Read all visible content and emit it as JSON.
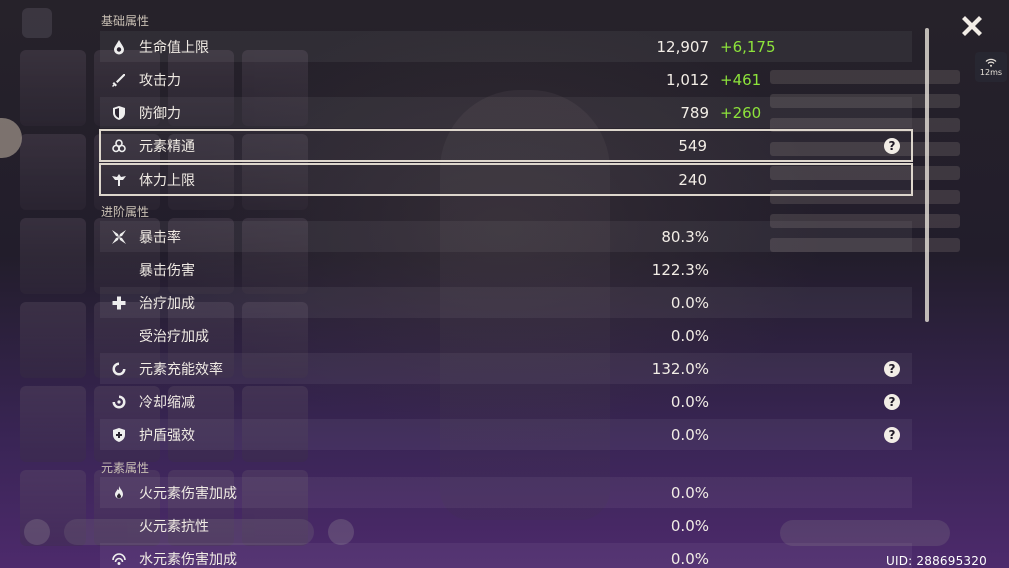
{
  "sections": {
    "base": "基础属性",
    "advanced": "进阶属性",
    "elemental": "元素属性"
  },
  "base_rows": [
    {
      "icon": "hp-drop-icon",
      "name": "生命值上限",
      "value": "12,907",
      "bonus": "+6,175"
    },
    {
      "icon": "sword-icon",
      "name": "攻击力",
      "value": "1,012",
      "bonus": "+461"
    },
    {
      "icon": "shield-icon",
      "name": "防御力",
      "value": "789",
      "bonus": "+260"
    },
    {
      "icon": "elemental-mastery-icon",
      "name": "元素精通",
      "value": "549",
      "help": "?"
    },
    {
      "icon": "stamina-icon",
      "name": "体力上限",
      "value": "240"
    }
  ],
  "advanced_rows": [
    {
      "icon": "crit-rate-icon",
      "name": "暴击率",
      "value": "80.3%"
    },
    {
      "icon": "",
      "name": "暴击伤害",
      "value": "122.3%"
    },
    {
      "icon": "healing-cross-icon",
      "name": "治疗加成",
      "value": "0.0%"
    },
    {
      "icon": "",
      "name": "受治疗加成",
      "value": "0.0%"
    },
    {
      "icon": "energy-recharge-icon",
      "name": "元素充能效率",
      "value": "132.0%",
      "help": "?"
    },
    {
      "icon": "cooldown-icon",
      "name": "冷却缩减",
      "value": "0.0%",
      "help": "?"
    },
    {
      "icon": "shield-strength-icon",
      "name": "护盾强效",
      "value": "0.0%",
      "help": "?"
    }
  ],
  "elemental_rows": [
    {
      "icon": "pyro-icon",
      "name": "火元素伤害加成",
      "value": "0.0%"
    },
    {
      "icon": "",
      "name": "火元素抗性",
      "value": "0.0%"
    },
    {
      "icon": "hydro-icon",
      "name": "水元素伤害加成",
      "value": "0.0%"
    }
  ],
  "ping": "12ms",
  "uid": "UID: 288695320",
  "colors": {
    "bonus": "#8de33b",
    "text": "#f0ebe4",
    "row_alt": "rgba(255,255,255,0.055)"
  }
}
